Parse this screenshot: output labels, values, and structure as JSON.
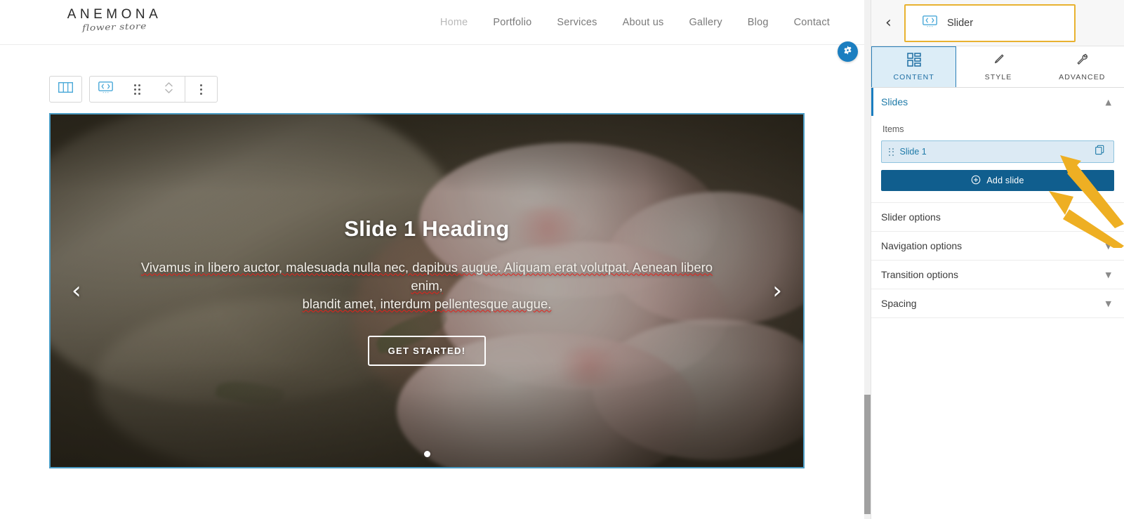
{
  "site": {
    "logo": {
      "name": "ANEMONA",
      "tagline": "flower store"
    },
    "nav": [
      {
        "label": "Home",
        "active": true
      },
      {
        "label": "Portfolio",
        "active": false
      },
      {
        "label": "Services",
        "active": false
      },
      {
        "label": "About us",
        "active": false
      },
      {
        "label": "Gallery",
        "active": false
      },
      {
        "label": "Blog",
        "active": false
      },
      {
        "label": "Contact",
        "active": false
      }
    ]
  },
  "toolbar": {
    "columns_icon": "columns-icon",
    "slider_icon": "slider-widget-icon",
    "drag_icon": "drag-handle-icon",
    "reorder_icon": "move-up-down-icon",
    "more_icon": "more-options-icon"
  },
  "slide": {
    "heading": "Slide 1 Heading",
    "paragraph_line1": "Vivamus in libero auctor, malesuada nulla nec, dapibus augue. Aliquam erat volutpat. Aenean libero enim,",
    "paragraph_line2": "blandit  amet, interdum pellentesque augue.",
    "cta_label": "GET STARTED!",
    "prev_arrow": "‹",
    "next_arrow": "›",
    "dots_count": 1
  },
  "fab": {
    "name": "settings-gear",
    "color": "#1b7ec0"
  },
  "panel": {
    "back_label": "‹",
    "title": "Slider",
    "title_icon": "slider-widget-icon",
    "highlight_color": "#e8b230",
    "accent_color": "#1b7ec0",
    "tabs": [
      {
        "label": "CONTENT",
        "icon": "layout-blocks-icon",
        "active": true
      },
      {
        "label": "STYLE",
        "icon": "paintbrush-icon",
        "active": false
      },
      {
        "label": "ADVANCED",
        "icon": "wrench-icon",
        "active": false
      }
    ],
    "sections": [
      {
        "label": "Slides",
        "open": true
      },
      {
        "label": "Slider options",
        "open": false
      },
      {
        "label": "Navigation options",
        "open": false
      },
      {
        "label": "Transition options",
        "open": false
      },
      {
        "label": "Spacing",
        "open": false
      }
    ],
    "slides_section": {
      "items_label": "Items",
      "items": [
        {
          "label": "Slide 1",
          "duplicate_icon": "duplicate-icon"
        }
      ],
      "add_button": {
        "label": "Add slide",
        "icon": "plus-circle-icon"
      }
    }
  }
}
